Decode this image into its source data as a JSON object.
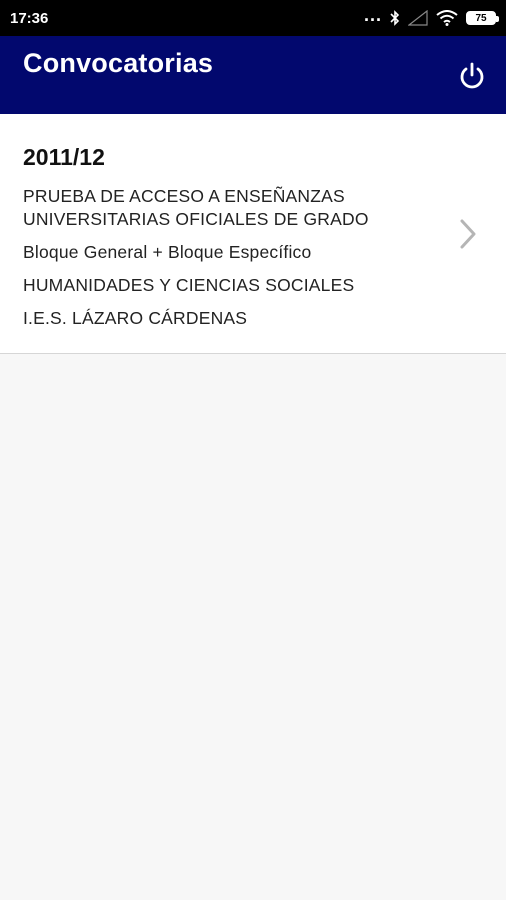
{
  "status_bar": {
    "time": "17:36",
    "dots": "...",
    "battery": "75"
  },
  "app_bar": {
    "title": "Convocatorias",
    "power_icon": "power-icon"
  },
  "convocatoria": {
    "year": "2011/12",
    "line1": "PRUEBA DE ACCESO A ENSEÑANZAS",
    "line2": "UNIVERSITARIAS OFICIALES DE GRADO",
    "line3": "Bloque General + Bloque Específico",
    "line4": "HUMANIDADES Y CIENCIAS SOCIALES",
    "line5": "I.E.S. LÁZARO CÁRDENAS",
    "chevron_icon": "chevron-right-icon"
  },
  "colors": {
    "app_bar": "#02086e",
    "status_bar": "#000000",
    "background": "#f7f7f7",
    "card": "#ffffff"
  }
}
